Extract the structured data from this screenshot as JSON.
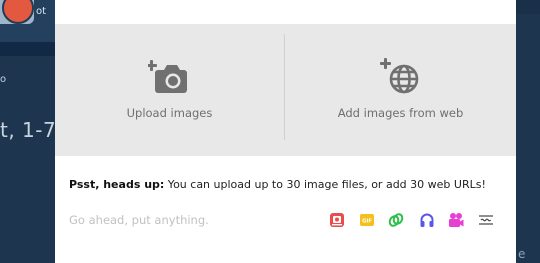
{
  "background": {
    "topbar_text": "ot",
    "bullet": "o",
    "heading": "t, 1-7",
    "right_letter": "e"
  },
  "upload": {
    "upload_images_label": "Upload images",
    "add_from_web_label": "Add images from web"
  },
  "hint": {
    "strong": "Psst, heads up:",
    "text": " You can upload up to 30 image files, or add 30 web URLs!"
  },
  "composer": {
    "placeholder": "Go ahead, put anything.",
    "value": ""
  },
  "toolbar_icons": [
    "photo-icon",
    "gif-icon",
    "link-icon",
    "audio-icon",
    "video-icon",
    "text-icon"
  ],
  "toolbar_colors": {
    "photo": "#ea4c4c",
    "gif": "#f3c01e",
    "link": "#2fbf4c",
    "audio": "#5a56e8",
    "video": "#e63fd1",
    "text": "#444444"
  },
  "gif_badge": "GIF"
}
